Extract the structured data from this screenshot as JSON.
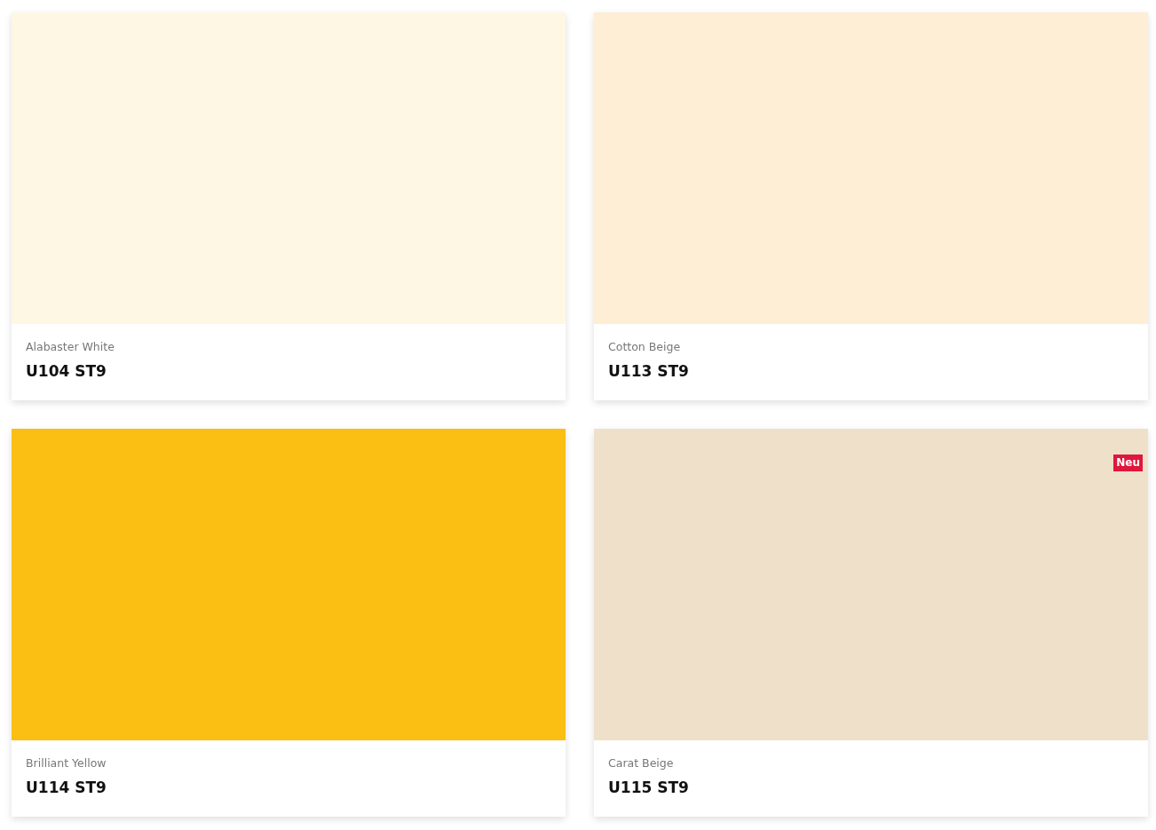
{
  "rows": [
    {
      "swatches": [
        {
          "name": "Alabaster White",
          "code": "U104 ST9",
          "color": "#fdf7e4"
        },
        {
          "name": "Cotton Beige",
          "code": "U113 ST9",
          "color": "#fdeed5"
        }
      ]
    },
    {
      "swatches": [
        {
          "name": "Brilliant Yellow",
          "code": "U114 ST9",
          "color": "#fbbe12"
        },
        {
          "name": "Carat Beige",
          "code": "U115 ST9",
          "color": "#efe1c9",
          "badge": "Neu"
        }
      ]
    }
  ]
}
